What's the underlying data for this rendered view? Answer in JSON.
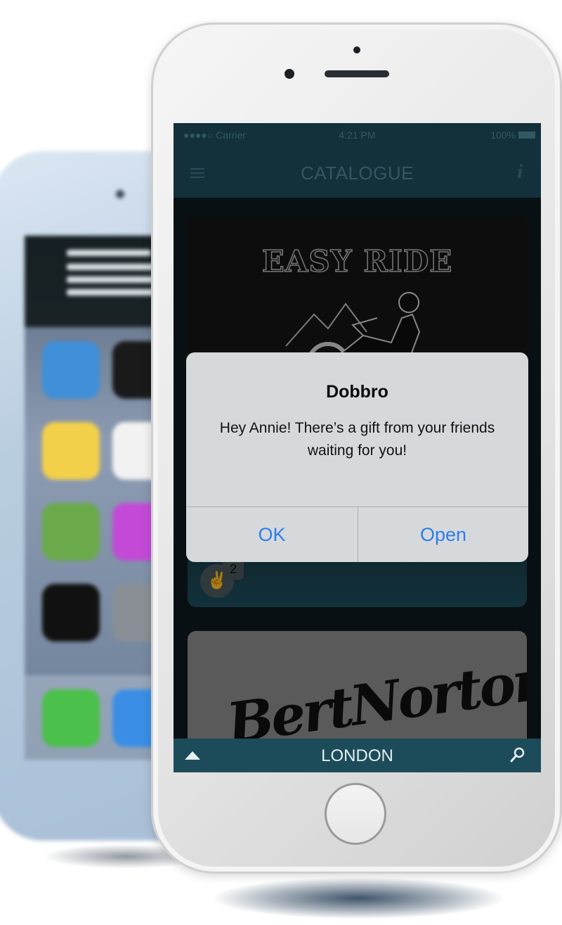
{
  "status_bar": {
    "carrier": "●●●●○ Carrier",
    "time": "4:21 PM",
    "battery": "100%"
  },
  "nav": {
    "title": "CATALOGUE",
    "info_label": "i"
  },
  "cards": [
    {
      "logo_text": "EASY RIDE",
      "peace_icon": "✌",
      "peace_count": "2"
    },
    {
      "logo_text": "BertNorton"
    }
  ],
  "bottom_bar": {
    "city": "LONDON"
  },
  "alert": {
    "title": "Dobbro",
    "message": "Hey Annie! There’s a gift from your friends waiting for you!",
    "ok_label": "OK",
    "open_label": "Open"
  },
  "colors": {
    "bar": "#1c4c5a",
    "alert_button": "#2f7dea"
  }
}
